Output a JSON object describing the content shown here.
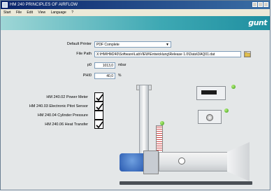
{
  "window": {
    "title": "HM 240 PRINCIPLES OF AIRFLOW"
  },
  "menu": [
    "Start",
    "File",
    "Edit",
    "View",
    "Language",
    "?"
  ],
  "banner": {
    "brand": "gunt"
  },
  "settings": {
    "default_printer_label": "Default Printer",
    "default_printer_value": "PDF Complete",
    "file_path_label": "File Path",
    "file_path_value": "X:\\HM\\HM240\\Software\\LabVIEW\\Entwicklung\\Release 1.0\\Data\\DAQ01.dat",
    "p0_label": "p0",
    "p0_value": "1013,0",
    "p0_unit": "mbar",
    "phi0_label": "PHI0",
    "phi0_value": "40,0",
    "phi0_unit": "%"
  },
  "modules": [
    {
      "label": "HM 240.02 Power Meter",
      "checked": true
    },
    {
      "label": "HM 240.03 Electronic Pitot Sensor",
      "checked": true
    },
    {
      "label": "HM 240.04 Cylinder Pressure",
      "checked": false
    },
    {
      "label": "HM 240.06 Heat Transfer",
      "checked": true
    }
  ],
  "icons": {
    "app": "app-icon",
    "browse": "folder-icon",
    "dropdown": "chevron-down-icon",
    "check": "checkmark-icon"
  },
  "colors": {
    "banner_start": "#9ed6d6",
    "banner_end": "#1f8fa0",
    "indicator_green": "#3a9a18"
  }
}
